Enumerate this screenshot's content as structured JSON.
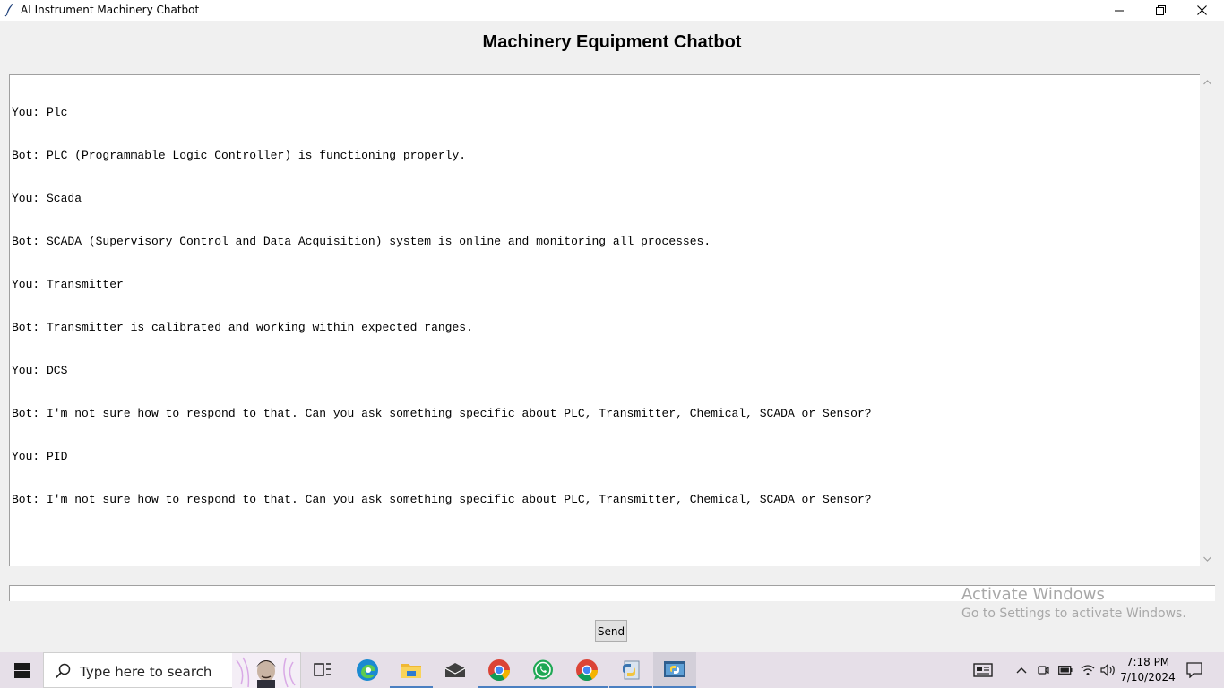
{
  "window": {
    "title": "AI Instrument Machinery Chatbot"
  },
  "heading": "Machinery Equipment Chatbot",
  "chat": {
    "lines": [
      "You: Plc",
      "Bot: PLC (Programmable Logic Controller) is functioning properly.",
      "You: Scada",
      "Bot: SCADA (Supervisory Control and Data Acquisition) system is online and monitoring all processes.",
      "You: Transmitter",
      "Bot: Transmitter is calibrated and working within expected ranges.",
      "You: DCS",
      "Bot: I'm not sure how to respond to that. Can you ask something specific about PLC, Transmitter, Chemical, SCADA or Sensor?",
      "You: PID",
      "Bot: I'm not sure how to respond to that. Can you ask something specific about PLC, Transmitter, Chemical, SCADA or Sensor?"
    ]
  },
  "input": {
    "value": ""
  },
  "send_label": "Send",
  "watermark": {
    "title": "Activate Windows",
    "subtitle": "Go to Settings to activate Windows."
  },
  "taskbar": {
    "search_placeholder": "Type here to search",
    "pinned": [
      "task-view",
      "edge",
      "file-explorer",
      "mail",
      "chrome",
      "whatsapp",
      "chrome-profile",
      "python-idle",
      "python-app"
    ],
    "clock_time": "7:18 PM",
    "clock_date": "7/10/2024"
  },
  "colors": {
    "accent": "#4a7fc1",
    "taskbar_bg": "#e6dfe8"
  }
}
